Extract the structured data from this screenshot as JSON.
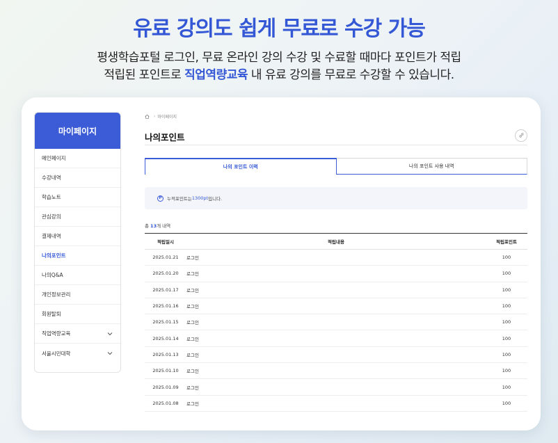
{
  "headline": "유료 강의도 쉽게 무료로 수강 가능",
  "subtitle": {
    "line1": "평생학습포털 로그인, 무료 온라인 강의 수강 및 수료할 때마다 포인트가 적립",
    "line2_before": "적립된 포인트로 ",
    "line2_highlight": "직업역량교육",
    "line2_after": " 내 유료 강의를 무료로 수강할 수 있습니다."
  },
  "sidebar": {
    "title": "마이페이지",
    "items": [
      {
        "label": "메인페이지"
      },
      {
        "label": "수강내역"
      },
      {
        "label": "학습노트"
      },
      {
        "label": "관심강의"
      },
      {
        "label": "결제내역"
      },
      {
        "label": "나의포인트",
        "active": true
      },
      {
        "label": "나의Q&A"
      },
      {
        "label": "개인정보관리"
      },
      {
        "label": "회원탈퇴"
      },
      {
        "label": "직업역량교육",
        "expandable": true
      },
      {
        "label": "서울시민대학",
        "expandable": true
      }
    ]
  },
  "breadcrumb": {
    "current": "마이페이지"
  },
  "page_title": "나의포인트",
  "tabs": [
    {
      "label": "나의 포인트 이력",
      "active": true
    },
    {
      "label": "나의 포인트 사용 내역",
      "active": false
    }
  ],
  "notice": {
    "icon_letter": "P",
    "before": "누적포인트는 ",
    "points": "1300pt",
    "after": "입니다."
  },
  "count": {
    "prefix": "총 ",
    "number": "13",
    "suffix": "개 내역"
  },
  "table": {
    "headers": {
      "date": "적립일시",
      "desc": "적립내용",
      "points": "적립포인트"
    },
    "rows": [
      {
        "date": "2025.01.21",
        "desc": "로그인",
        "points": "100"
      },
      {
        "date": "2025.01.20",
        "desc": "로그인",
        "points": "100"
      },
      {
        "date": "2025.01.17",
        "desc": "로그인",
        "points": "100"
      },
      {
        "date": "2025.01.16",
        "desc": "로그인",
        "points": "100"
      },
      {
        "date": "2025.01.15",
        "desc": "로그인",
        "points": "100"
      },
      {
        "date": "2025.01.14",
        "desc": "로그인",
        "points": "100"
      },
      {
        "date": "2025.01.13",
        "desc": "로그인",
        "points": "100"
      },
      {
        "date": "2025.01.10",
        "desc": "로그인",
        "points": "100"
      },
      {
        "date": "2025.01.09",
        "desc": "로그인",
        "points": "100"
      },
      {
        "date": "2025.01.08",
        "desc": "로그인",
        "points": "100"
      }
    ]
  },
  "colors": {
    "accent": "#3b5bd7",
    "headline": "#3457d6"
  },
  "icons": {
    "home": "home-icon",
    "link": "link-icon",
    "chevron": "chevron-down-icon"
  }
}
